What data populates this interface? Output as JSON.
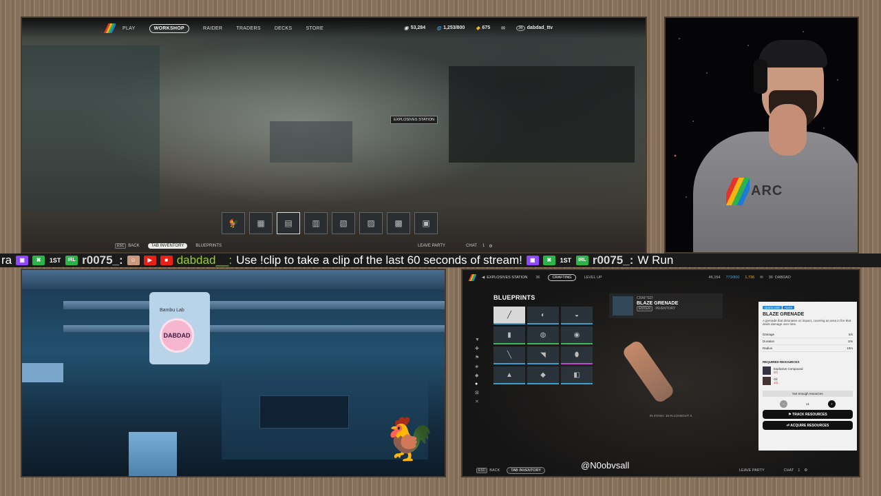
{
  "game": {
    "nav": [
      "PLAY",
      "WORKSHOP",
      "RAIDER",
      "TRADERS",
      "DECKS",
      "STORE"
    ],
    "active_nav": "WORKSHOP",
    "stats": {
      "coins": "53,284",
      "capacity": "1,253/800",
      "tokens": "675",
      "level": "36",
      "user": "dabdad_ttv"
    },
    "tooltip": "EXPLOSIVES STATION",
    "footer": {
      "back_key": "ESC",
      "back": "BACK",
      "tab_key": "TAB",
      "inventory": "INVENTORY",
      "blueprints": "BLUEPRINTS",
      "leave_party": "LEAVE PARTY",
      "chat": "CHAT",
      "party_count": "1"
    }
  },
  "ticker": {
    "prefix": "ra",
    "badge_1st": "1ST",
    "badge_irl": "IRL",
    "user1": "r0075_:",
    "user2": "dabdad__:",
    "message": "Use !clip to take a clip of the last 60 seconds of stream!",
    "user3": "r0075_:",
    "message2": "W Run"
  },
  "printer": {
    "brand": "Bambu Lab",
    "sticker": "DABDAD"
  },
  "craft": {
    "header": {
      "station": "EXPLOSIVES STATION",
      "level": "36",
      "crafting": "CRAFTING",
      "level_up": "LEVEL UP",
      "coins": "46,154",
      "capacity": "773/800",
      "tokens": "1,736",
      "user": "DABDAD"
    },
    "title": "BLUEPRINTS",
    "crafted": {
      "label": "CRAFTED",
      "name": "BLAZE GRENADE",
      "enter_key": "ENTER",
      "inventory": "INVENTORY"
    },
    "stash": "IN STASH: 18   IN LOADOUT: 0",
    "card": {
      "tag1": "QUICK USE",
      "tag2": "RARE",
      "name": "BLAZE GRENADE",
      "desc": "A grenade that detonates on impact, covering an area in fire that deals damage over time.",
      "stats": [
        {
          "k": "Damage",
          "v": "5/s"
        },
        {
          "k": "Duration",
          "v": "10s"
        },
        {
          "k": "Radius",
          "v": "10m"
        }
      ],
      "req_title": "REQUIRED RESOURCES",
      "resources": [
        {
          "name": "Explosive Compound",
          "qty": "0/1"
        },
        {
          "name": "Oil",
          "qty": "1/2"
        }
      ],
      "not_enough": "Not enough resources",
      "qty": "x1",
      "track": "TRACK RESOURCES",
      "acquire": "ACQUIRE RESOURCES"
    },
    "footer": {
      "back_key": "ESC",
      "back": "BACK",
      "tab_key": "TAB",
      "inventory": "INVENTORY",
      "leave_party": "LEAVE PARTY",
      "chat": "CHAT",
      "party_count": "1"
    }
  },
  "watermark": "@N0obvsall"
}
